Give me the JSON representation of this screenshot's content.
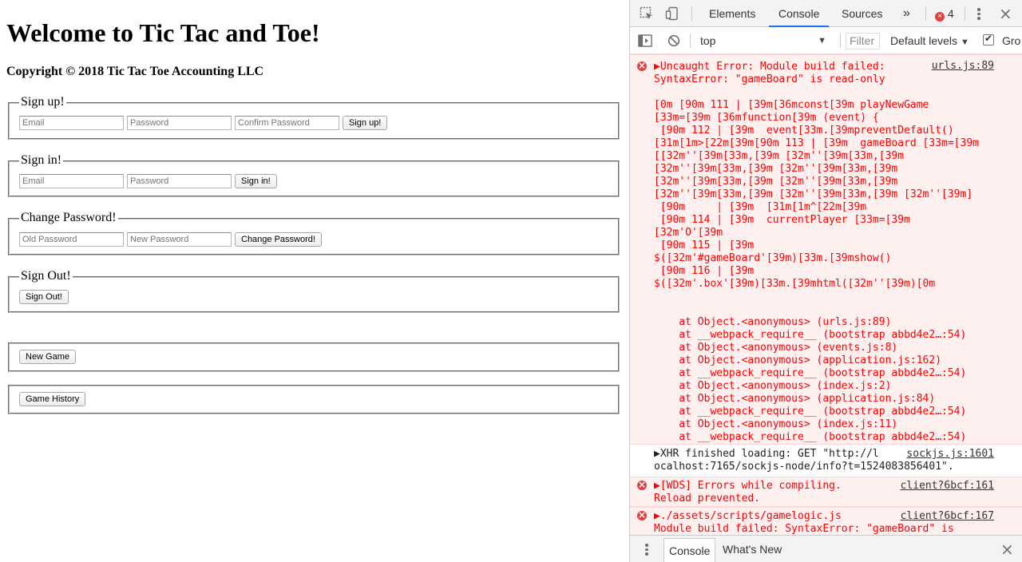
{
  "page": {
    "title": "Welcome to Tic Tac and Toe!",
    "copyright": "Copyright © 2018 Tic Tac Toe Accounting LLC"
  },
  "signup": {
    "legend": "Sign up!",
    "email_ph": "Email",
    "password_ph": "Password",
    "confirm_ph": "Confirm Password",
    "button": "Sign up!"
  },
  "signin": {
    "legend": "Sign in!",
    "email_ph": "Email",
    "password_ph": "Password",
    "button": "Sign in!"
  },
  "changepw": {
    "legend": "Change Password!",
    "old_ph": "Old Password",
    "new_ph": "New Password",
    "button": "Change Password!"
  },
  "signout": {
    "legend": "Sign Out!",
    "button": "Sign Out!"
  },
  "newgame": {
    "button": "New Game"
  },
  "history": {
    "button": "Game History"
  },
  "devtools": {
    "tabs": [
      "Elements",
      "Console",
      "Sources"
    ],
    "more": "»",
    "error_count": "4",
    "context": "top",
    "filter_placeholder": "Filter",
    "levels": "Default levels",
    "group_label": "Gro",
    "messages": [
      {
        "type": "error",
        "source": "urls.js:89",
        "lines": [
          "▶Uncaught Error: Module build failed:",
          "SyntaxError: \"gameBoard\" is read-only",
          "",
          "[0m [90m 111 | [39m[36mconst[39m playNewGame",
          "[33m=[39m [36mfunction[39m (event) {",
          " [90m 112 | [39m  event[33m.[39mpreventDefault()",
          "[31m[1m>[22m[39m[90m 113 | [39m  gameBoard [33m=[39m",
          "[[32m''[39m[33m,[39m [32m''[39m[33m,[39m",
          "[32m''[39m[33m,[39m [32m''[39m[33m,[39m",
          "[32m''[39m[33m,[39m [32m''[39m[33m,[39m",
          "[32m''[39m[33m,[39m [32m''[39m[33m,[39m [32m''[39m]",
          " [90m     | [39m  [31m[1m^[22m[39m",
          " [90m 114 | [39m  currentPlayer [33m=[39m",
          "[32m'O'[39m",
          " [90m 115 | [39m",
          "$([32m'#gameBoard'[39m)[33m.[39mshow()",
          " [90m 116 | [39m",
          "$([32m'.box'[39m)[33m.[39mhtml([32m''[39m)[0m",
          "",
          "",
          "    at Object.<anonymous> (urls.js:89)",
          "    at __webpack_require__ (bootstrap abbd4e2…:54)",
          "    at Object.<anonymous> (events.js:8)",
          "    at Object.<anonymous> (application.js:162)",
          "    at __webpack_require__ (bootstrap abbd4e2…:54)",
          "    at Object.<anonymous> (index.js:2)",
          "    at Object.<anonymous> (application.js:84)",
          "    at __webpack_require__ (bootstrap abbd4e2…:54)",
          "    at Object.<anonymous> (index.js:11)",
          "    at __webpack_require__ (bootstrap abbd4e2…:54)"
        ]
      },
      {
        "type": "info",
        "source": "sockjs.js:1601",
        "lines": [
          "▶XHR finished loading: GET \"http://l",
          "ocalhost:7165/sockjs-node/info?t=1524083856401\"."
        ]
      },
      {
        "type": "error",
        "source": "client?6bcf:161",
        "lines": [
          "▶[WDS] Errors while compiling.",
          "Reload prevented."
        ]
      },
      {
        "type": "error",
        "source": "client?6bcf:167",
        "lines": [
          "▶./assets/scripts/gamelogic.js",
          "Module build failed: SyntaxError: \"gameBoard\" is"
        ]
      }
    ],
    "drawer_tabs": [
      "Console",
      "What's New"
    ]
  }
}
